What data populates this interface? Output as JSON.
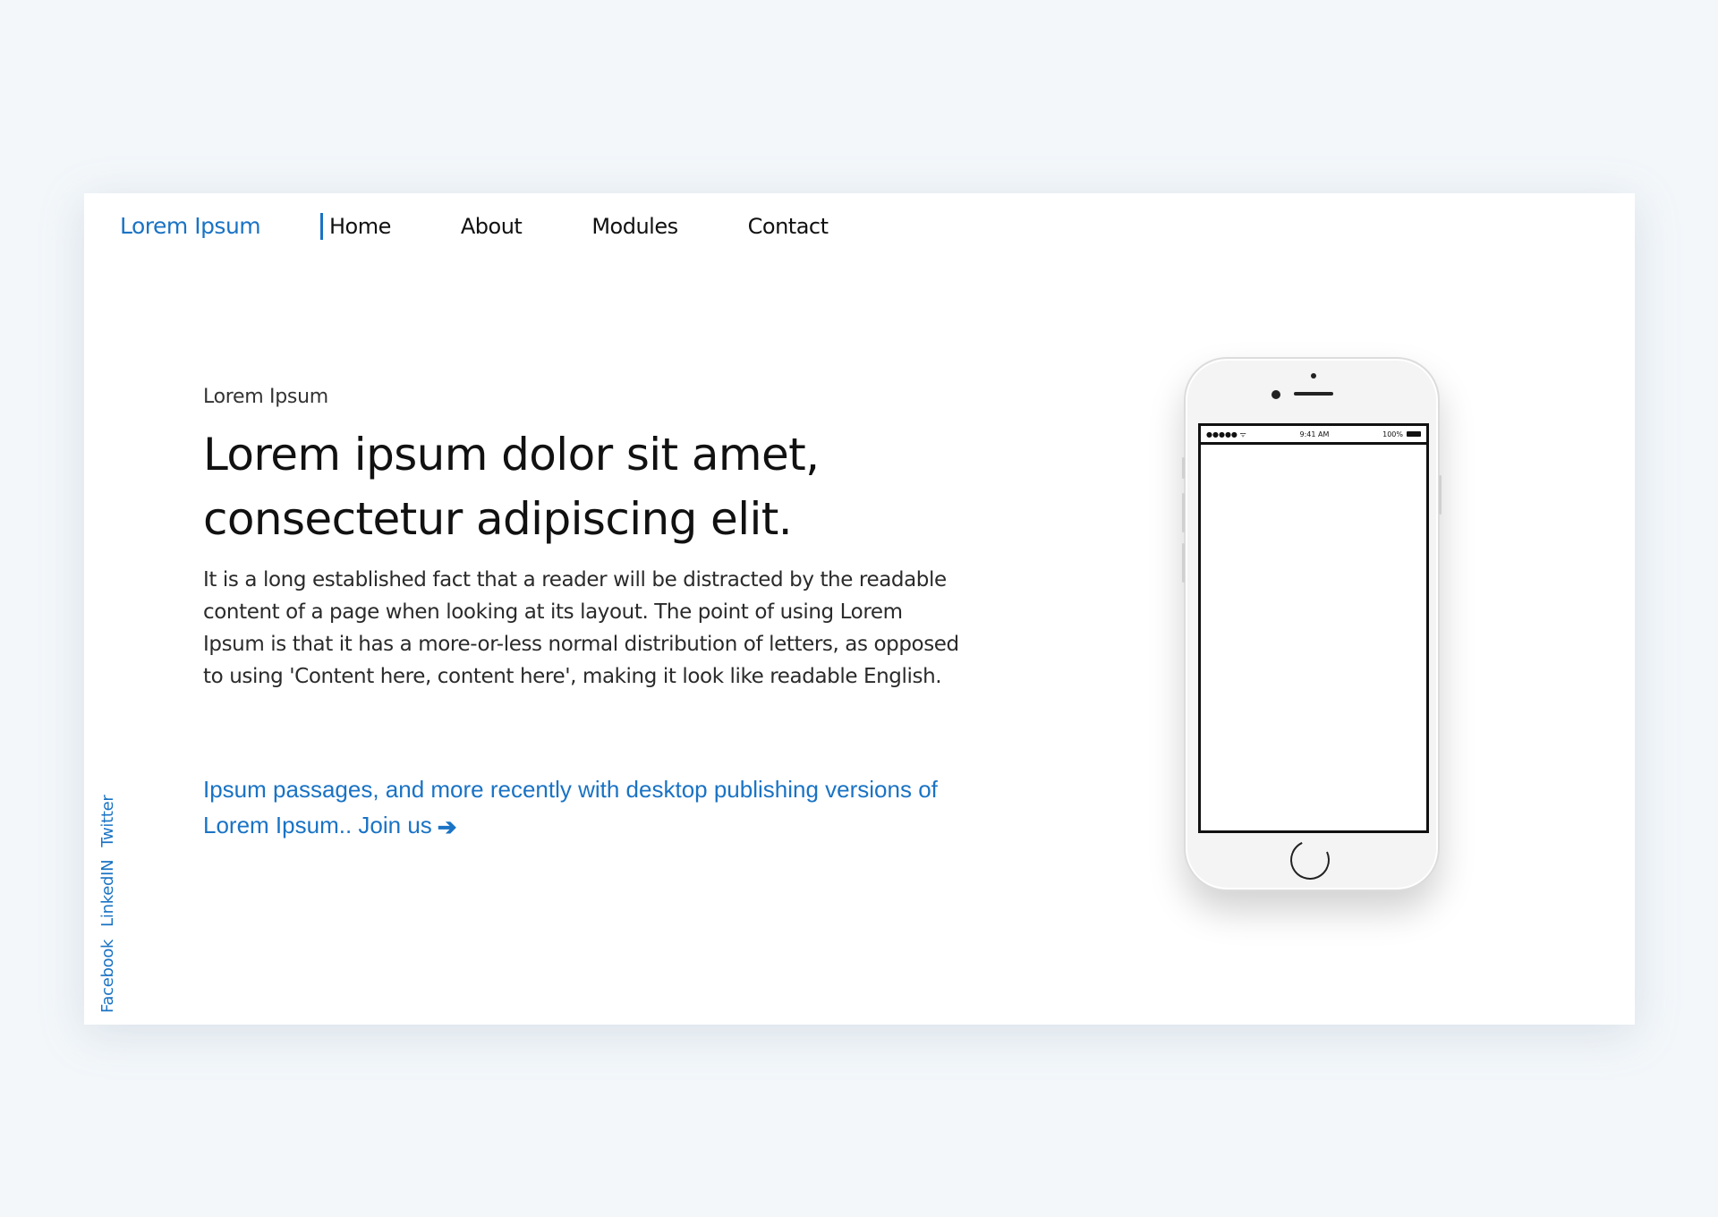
{
  "nav": {
    "brand": "Lorem Ipsum",
    "items": [
      {
        "label": "Home",
        "active": true
      },
      {
        "label": "About"
      },
      {
        "label": "Modules"
      },
      {
        "label": "Contact"
      }
    ]
  },
  "hero": {
    "kicker": "Lorem Ipsum",
    "headline_line1": "Lorem ipsum dolor sit amet,",
    "headline_line2": "consectetur adipiscing elit.",
    "paragraph": "It is a long established fact that a reader will be distracted by the readable content of a page when looking at its layout. The point of using Lorem Ipsum is that it has a more-or-less normal distribution of letters, as opposed to using 'Content here, content here', making it look like readable English.",
    "cta": "Ipsum passages, and more recently with desktop publishing versions of Lorem Ipsum.. Join us",
    "cta_arrow": "➔"
  },
  "social": {
    "items": [
      "Facebook",
      "LinkedIN",
      "Twitter"
    ]
  },
  "phone": {
    "status_signal": "●●●●● ᯤ",
    "status_time": "9:41 AM",
    "status_battery": "100%"
  },
  "colors": {
    "accent": "#1a73c4",
    "background": "#f3f7fa",
    "card": "#ffffff"
  }
}
